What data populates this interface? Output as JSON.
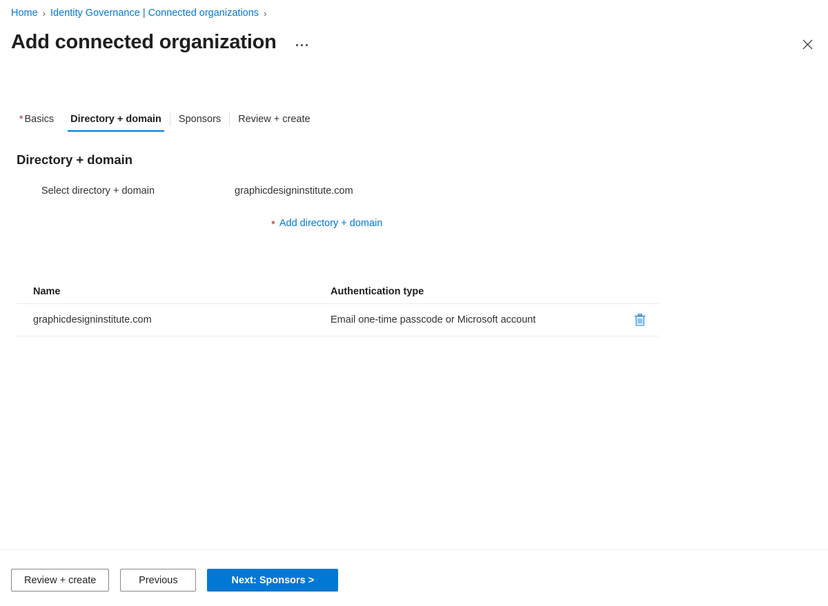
{
  "breadcrumb": {
    "items": [
      {
        "label": "Home"
      },
      {
        "label": "Identity Governance | Connected organizations"
      }
    ],
    "separator": "›"
  },
  "header": {
    "title": "Add connected organization",
    "more_menu_label": "…",
    "close_label": "✕"
  },
  "tabs": [
    {
      "label": "Basics",
      "required": true,
      "active": false
    },
    {
      "label": "Directory + domain",
      "required": false,
      "active": true
    },
    {
      "label": "Sponsors",
      "required": false,
      "active": false
    },
    {
      "label": "Review + create",
      "required": false,
      "active": false
    }
  ],
  "section": {
    "heading": "Directory + domain",
    "field_label": "Select directory + domain",
    "field_value": "graphicdesigninstitute.com",
    "add_link_star": "*",
    "add_link_label": "Add directory + domain"
  },
  "table": {
    "columns": [
      "Name",
      "Authentication type"
    ],
    "rows": [
      {
        "name": "graphicdesigninstitute.com",
        "authentication_type": "Email one-time passcode or Microsoft account",
        "delete_icon": "delete-icon"
      }
    ]
  },
  "footer": {
    "review_create_label": "Review + create",
    "previous_label": "Previous",
    "next_label": "Next: Sponsors >"
  },
  "colors": {
    "accent": "#0078d4",
    "link": "#0078d4",
    "required_star": "#a4262c",
    "text": "#323130",
    "heading": "#201f1e",
    "divider": "#edebe9"
  }
}
